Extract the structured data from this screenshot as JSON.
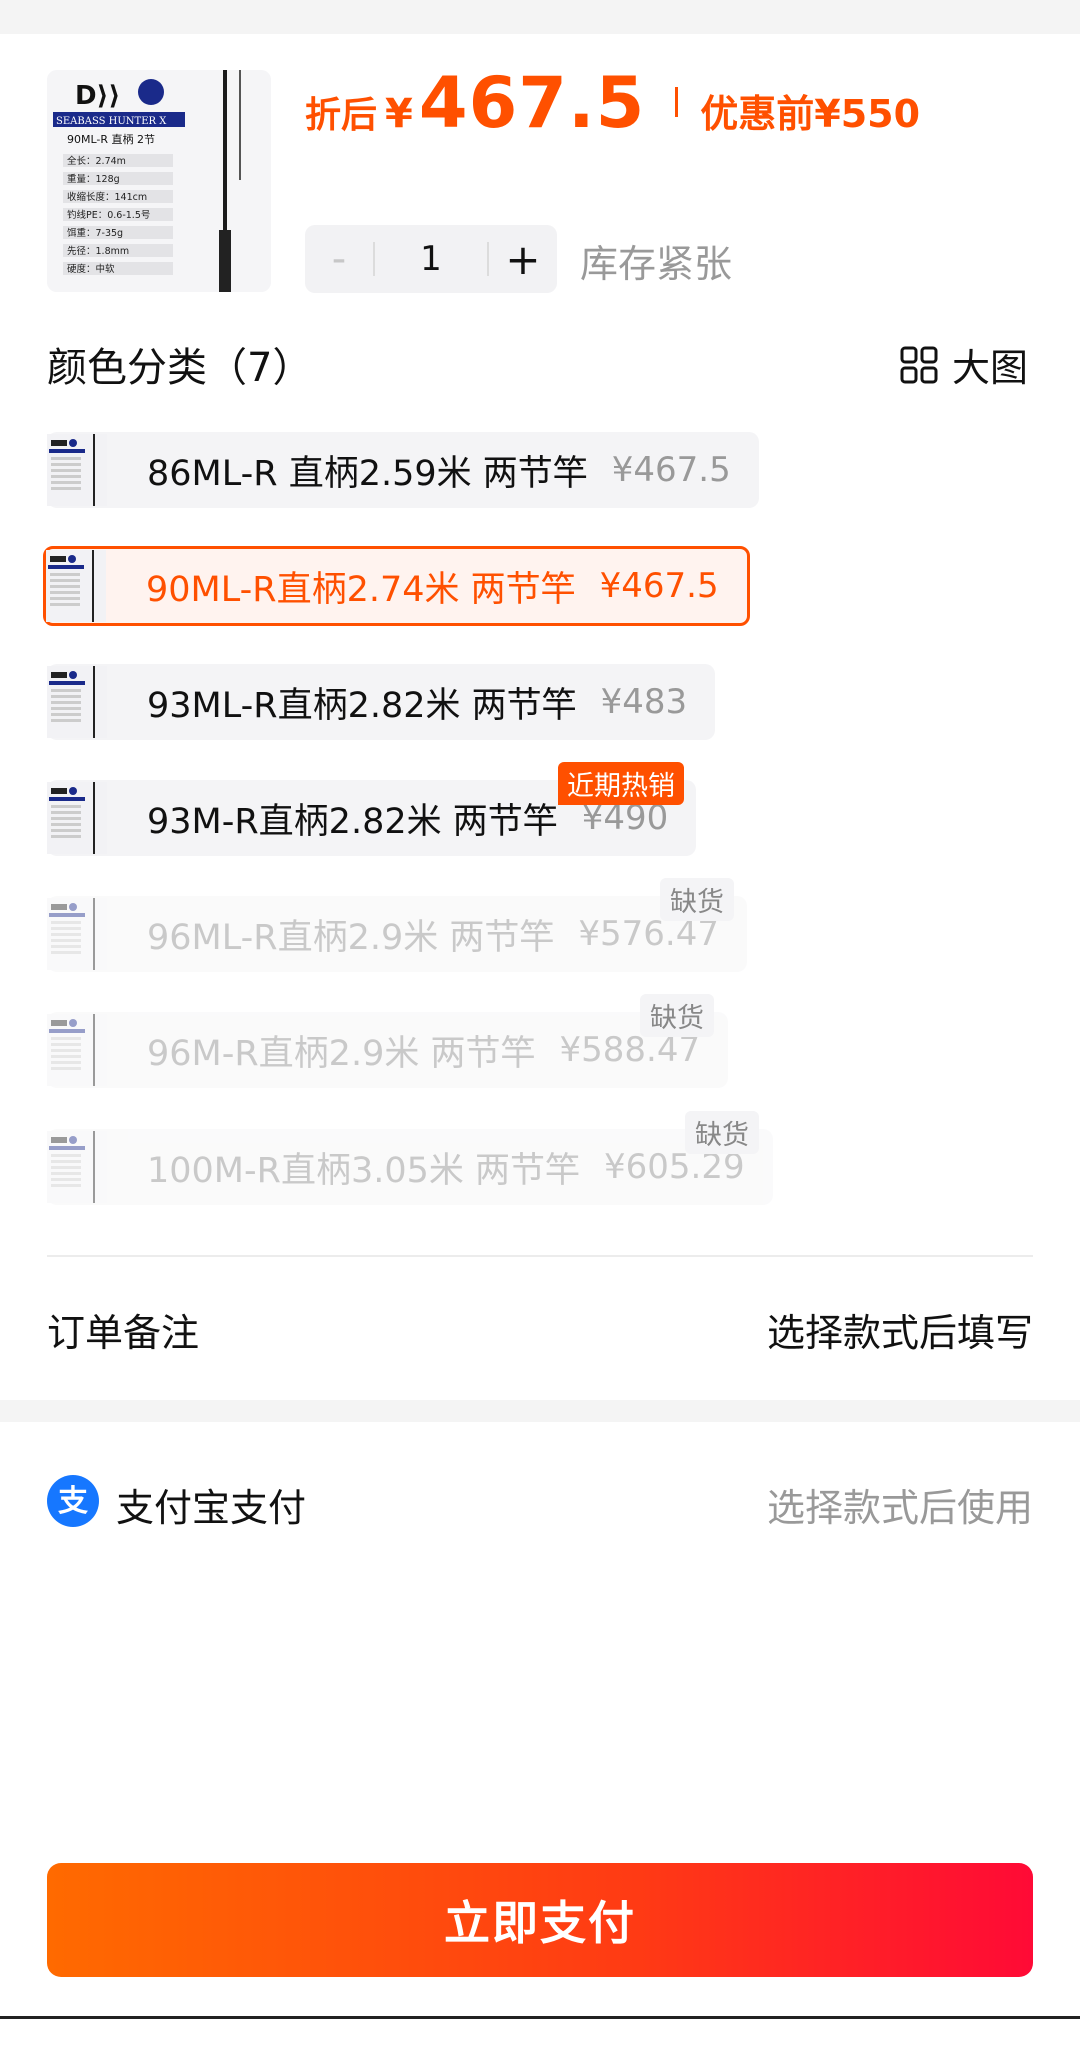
{
  "product": {
    "price_label": "折后",
    "currency": "¥",
    "price": "467.5",
    "original_label": "优惠前¥550",
    "thumb_text": {
      "brand_line": "SEABASS HUNTER X",
      "model": "90ML-R 直柄 2节",
      "specs": [
        "全长：2.74m",
        "重量：128g",
        "收缩长度：141cm",
        "钓线PE：0.6-1.5号",
        "饵重：7-35g",
        "先径：1.8mm",
        "硬度：中软"
      ]
    }
  },
  "quantity": {
    "minus": "-",
    "value": "1",
    "plus": "+",
    "stock_note": "库存紧张"
  },
  "section": {
    "title": "颜色分类（7）",
    "big_view": "大图"
  },
  "skus": [
    {
      "name": "86ML-R 直柄2.59米 两节竿",
      "price": "¥467.5",
      "state": "normal"
    },
    {
      "name": "90ML-R直柄2.74米 两节竿",
      "price": "¥467.5",
      "state": "selected"
    },
    {
      "name": "93ML-R直柄2.82米 两节竿",
      "price": "¥483",
      "state": "normal"
    },
    {
      "name": "93M-R直柄2.82米 两节竿",
      "price": "¥490",
      "state": "normal",
      "badge": "近期热销"
    },
    {
      "name": "96ML-R直柄2.9米 两节竿",
      "price": "¥576.47",
      "state": "out",
      "badge": "缺货"
    },
    {
      "name": "96M-R直柄2.9米 两节竿",
      "price": "¥588.47",
      "state": "out",
      "badge": "缺货"
    },
    {
      "name": "100M-R直柄3.05米 两节竿",
      "price": "¥605.29",
      "state": "out",
      "badge": "缺货"
    }
  ],
  "order_note": {
    "label": "订单备注",
    "value": "选择款式后填写"
  },
  "payment": {
    "label": "支付宝支付",
    "value": "选择款式后使用",
    "icon": "alipay-icon",
    "brand_color": "#1677ff"
  },
  "pay_button": {
    "label": "立即支付"
  },
  "colors": {
    "accent": "#ff5000"
  }
}
